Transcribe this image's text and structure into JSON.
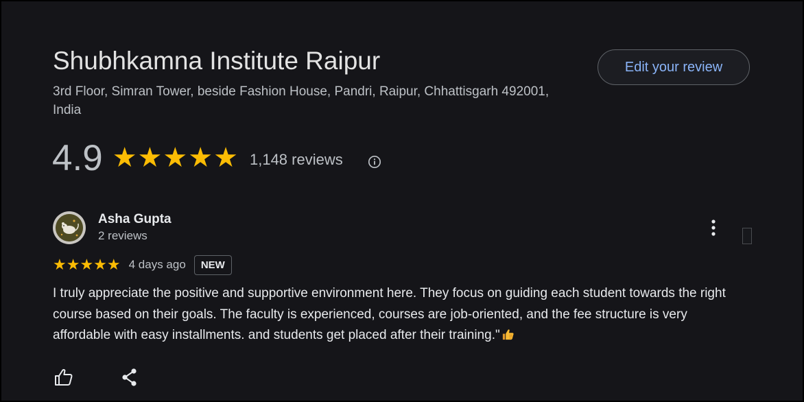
{
  "place": {
    "name": "Shubhkamna Institute Raipur",
    "address": "3rd Floor, Simran Tower, beside Fashion House, Pandri, Raipur, Chhattisgarh 492001, India"
  },
  "actions": {
    "edit_review_label": "Edit your review"
  },
  "rating": {
    "value": "4.9",
    "stars_display": "★★★★★",
    "stars_filled": 5,
    "stars_total": 5,
    "review_count": "1,148 reviews",
    "info_icon": "info-icon"
  },
  "review": {
    "reviewer_name": "Asha Gupta",
    "reviewer_meta": "2 reviews",
    "stars_display": "★★★★★",
    "stars_filled": 5,
    "time_ago": "4 days ago",
    "badge": "NEW",
    "text": "I truly appreciate the positive and supportive environment here. They focus on guiding each student towards the right course based on their goals. The faculty is experienced, courses are job-oriented, and the fee structure is very affordable with easy installments. and students get placed after their training.\"",
    "emoji_icon": "thumbs-up-emoji",
    "more_icon": "more-vert-icon",
    "like_icon": "thumb-up-icon",
    "share_icon": "share-icon"
  },
  "colors": {
    "background": "#151519",
    "accent_link": "#8ab4f8",
    "star": "#fbbc04"
  }
}
